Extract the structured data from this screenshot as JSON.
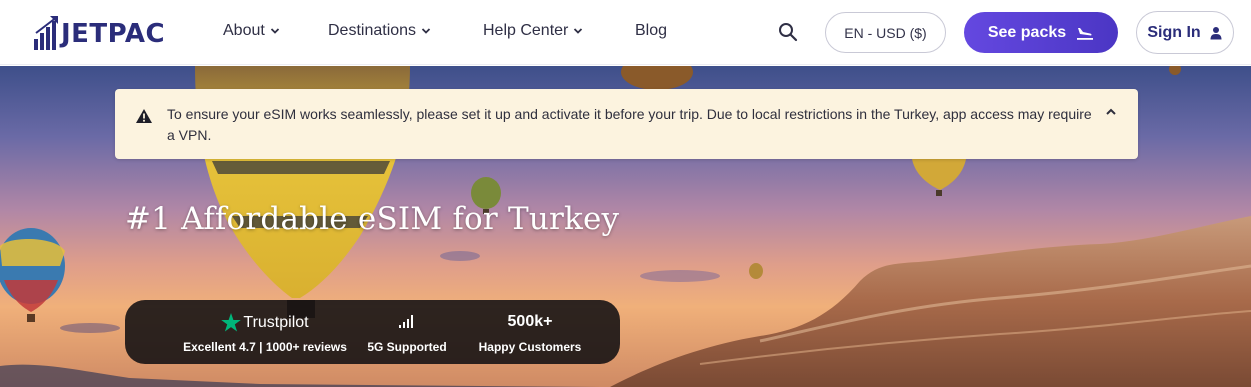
{
  "brand": {
    "name": "JETPAC"
  },
  "nav": {
    "items": [
      {
        "label": "About",
        "has_dropdown": true
      },
      {
        "label": "Destinations",
        "has_dropdown": true
      },
      {
        "label": "Help Center",
        "has_dropdown": true
      },
      {
        "label": "Blog",
        "has_dropdown": false
      }
    ],
    "currency_label": "EN - USD ($)",
    "cta_label": "See packs",
    "signin_label": "Sign In"
  },
  "alert": {
    "icon": "warning-icon",
    "message": "To ensure your eSIM works seamlessly, please set it up and activate it before your trip. Due to local restrictions in the Turkey, app access may require a VPN."
  },
  "hero": {
    "title": "#1 Affordable eSIM for Turkey"
  },
  "stats": [
    {
      "headline": "Trustpilot",
      "icon": "trustpilot-star-icon",
      "caption": "Excellent 4.7 | 1000+ reviews"
    },
    {
      "headline": "",
      "icon": "signal-bars-icon",
      "caption": "5G Supported"
    },
    {
      "headline": "500k+",
      "icon": "",
      "caption": "Happy Customers"
    }
  ],
  "colors": {
    "brand_navy": "#2b2d7a",
    "cta_purple": "#5840d8",
    "alert_bg": "#fcf3df",
    "trustpilot_green": "#00b67a"
  }
}
